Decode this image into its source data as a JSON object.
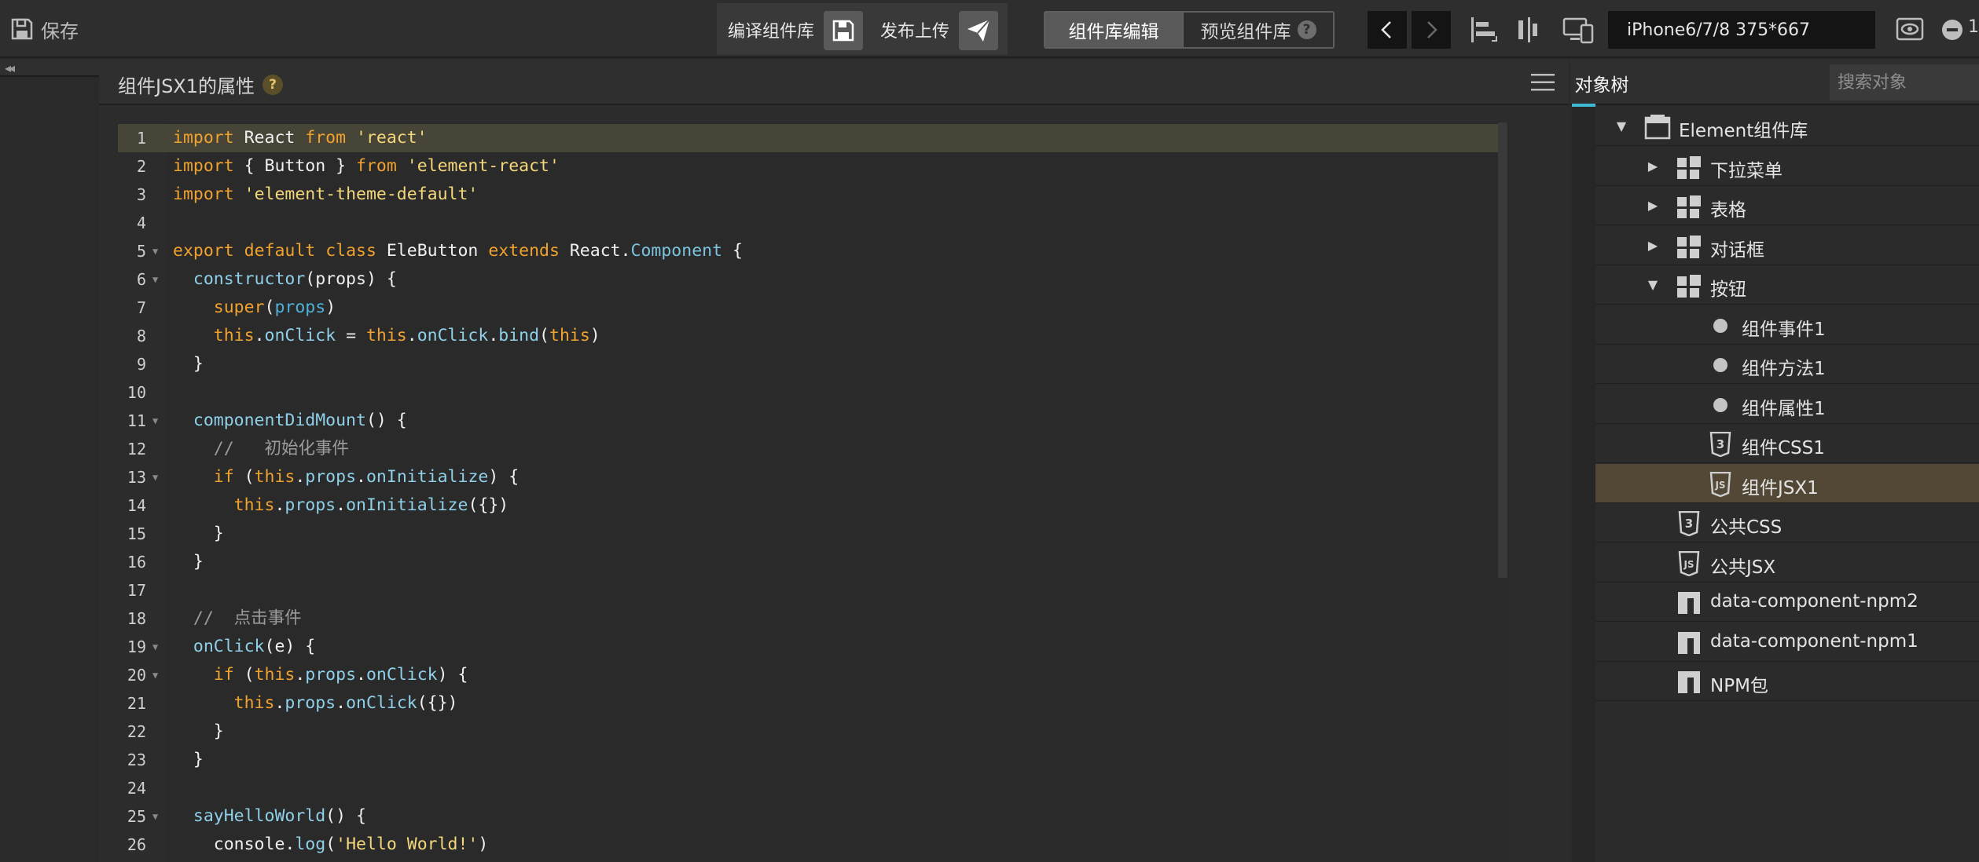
{
  "toolbar": {
    "save_label": "保存",
    "compile_label": "编译组件库",
    "publish_label": "发布上传",
    "mode_edit_label": "组件库编辑",
    "mode_preview_label": "预览组件库",
    "help_symbol": "?",
    "device_label": "iPhone6/7/8 375*667",
    "zoom_label": "1"
  },
  "left_strip": {
    "collapse_symbol": "◂◂"
  },
  "panel": {
    "title": "组件JSX1的属性",
    "help_symbol": "?"
  },
  "editor": {
    "active_line": 1,
    "lines": [
      {
        "n": "1",
        "fold": false,
        "tokens": [
          [
            "kw",
            "import"
          ],
          [
            "plain",
            " React "
          ],
          [
            "kw",
            "from"
          ],
          [
            "plain",
            " "
          ],
          [
            "str",
            "'react'"
          ]
        ]
      },
      {
        "n": "2",
        "fold": false,
        "tokens": [
          [
            "kw",
            "import"
          ],
          [
            "plain",
            " { Button } "
          ],
          [
            "kw",
            "from"
          ],
          [
            "plain",
            " "
          ],
          [
            "str",
            "'element-react'"
          ]
        ]
      },
      {
        "n": "3",
        "fold": false,
        "tokens": [
          [
            "kw",
            "import"
          ],
          [
            "plain",
            " "
          ],
          [
            "str",
            "'element-theme-default'"
          ]
        ]
      },
      {
        "n": "4",
        "fold": false,
        "tokens": []
      },
      {
        "n": "5",
        "fold": true,
        "tokens": [
          [
            "kw",
            "export"
          ],
          [
            "plain",
            " "
          ],
          [
            "kw",
            "default"
          ],
          [
            "plain",
            " "
          ],
          [
            "kw",
            "class"
          ],
          [
            "plain",
            " EleButton "
          ],
          [
            "kw",
            "extends"
          ],
          [
            "plain",
            " React."
          ],
          [
            "cls",
            "Component"
          ],
          [
            "plain",
            " {"
          ]
        ]
      },
      {
        "n": "6",
        "fold": true,
        "tokens": [
          [
            "plain",
            "  "
          ],
          [
            "fn",
            "constructor"
          ],
          [
            "plain",
            "(props) {"
          ]
        ]
      },
      {
        "n": "7",
        "fold": false,
        "tokens": [
          [
            "plain",
            "    "
          ],
          [
            "kw",
            "super"
          ],
          [
            "plain",
            "("
          ],
          [
            "param",
            "props"
          ],
          [
            "plain",
            ")"
          ]
        ]
      },
      {
        "n": "8",
        "fold": false,
        "tokens": [
          [
            "plain",
            "    "
          ],
          [
            "this",
            "this"
          ],
          [
            "plain",
            "."
          ],
          [
            "fn",
            "onClick"
          ],
          [
            "plain",
            " = "
          ],
          [
            "this",
            "this"
          ],
          [
            "plain",
            "."
          ],
          [
            "fn",
            "onClick"
          ],
          [
            "plain",
            "."
          ],
          [
            "fn",
            "bind"
          ],
          [
            "plain",
            "("
          ],
          [
            "this",
            "this"
          ],
          [
            "plain",
            ")"
          ]
        ]
      },
      {
        "n": "9",
        "fold": false,
        "tokens": [
          [
            "plain",
            "  }"
          ]
        ]
      },
      {
        "n": "10",
        "fold": false,
        "tokens": []
      },
      {
        "n": "11",
        "fold": true,
        "tokens": [
          [
            "plain",
            "  "
          ],
          [
            "fn",
            "componentDidMount"
          ],
          [
            "plain",
            "() {"
          ]
        ]
      },
      {
        "n": "12",
        "fold": false,
        "tokens": [
          [
            "plain",
            "    "
          ],
          [
            "cm",
            "//   初始化事件"
          ]
        ]
      },
      {
        "n": "13",
        "fold": true,
        "tokens": [
          [
            "plain",
            "    "
          ],
          [
            "kw",
            "if"
          ],
          [
            "plain",
            " ("
          ],
          [
            "this",
            "this"
          ],
          [
            "plain",
            "."
          ],
          [
            "fn",
            "props"
          ],
          [
            "plain",
            "."
          ],
          [
            "fn",
            "onInitialize"
          ],
          [
            "plain",
            ") {"
          ]
        ]
      },
      {
        "n": "14",
        "fold": false,
        "tokens": [
          [
            "plain",
            "      "
          ],
          [
            "this",
            "this"
          ],
          [
            "plain",
            "."
          ],
          [
            "fn",
            "props"
          ],
          [
            "plain",
            "."
          ],
          [
            "fn",
            "onInitialize"
          ],
          [
            "plain",
            "({})"
          ]
        ]
      },
      {
        "n": "15",
        "fold": false,
        "tokens": [
          [
            "plain",
            "    }"
          ]
        ]
      },
      {
        "n": "16",
        "fold": false,
        "tokens": [
          [
            "plain",
            "  }"
          ]
        ]
      },
      {
        "n": "17",
        "fold": false,
        "tokens": []
      },
      {
        "n": "18",
        "fold": false,
        "tokens": [
          [
            "plain",
            "  "
          ],
          [
            "cm",
            "//  点击事件"
          ]
        ]
      },
      {
        "n": "19",
        "fold": true,
        "tokens": [
          [
            "plain",
            "  "
          ],
          [
            "fn",
            "onClick"
          ],
          [
            "plain",
            "(e) {"
          ]
        ]
      },
      {
        "n": "20",
        "fold": true,
        "tokens": [
          [
            "plain",
            "    "
          ],
          [
            "kw",
            "if"
          ],
          [
            "plain",
            " ("
          ],
          [
            "this",
            "this"
          ],
          [
            "plain",
            "."
          ],
          [
            "fn",
            "props"
          ],
          [
            "plain",
            "."
          ],
          [
            "fn",
            "onClick"
          ],
          [
            "plain",
            ") {"
          ]
        ]
      },
      {
        "n": "21",
        "fold": false,
        "tokens": [
          [
            "plain",
            "      "
          ],
          [
            "this",
            "this"
          ],
          [
            "plain",
            "."
          ],
          [
            "fn",
            "props"
          ],
          [
            "plain",
            "."
          ],
          [
            "fn",
            "onClick"
          ],
          [
            "plain",
            "({})"
          ]
        ]
      },
      {
        "n": "22",
        "fold": false,
        "tokens": [
          [
            "plain",
            "    }"
          ]
        ]
      },
      {
        "n": "23",
        "fold": false,
        "tokens": [
          [
            "plain",
            "  }"
          ]
        ]
      },
      {
        "n": "24",
        "fold": false,
        "tokens": []
      },
      {
        "n": "25",
        "fold": true,
        "tokens": [
          [
            "plain",
            "  "
          ],
          [
            "fn",
            "sayHelloWorld"
          ],
          [
            "plain",
            "() {"
          ]
        ]
      },
      {
        "n": "26",
        "fold": false,
        "tokens": [
          [
            "plain",
            "    console."
          ],
          [
            "fn",
            "log"
          ],
          [
            "plain",
            "("
          ],
          [
            "str",
            "'Hello World!'"
          ],
          [
            "plain",
            ")"
          ]
        ]
      }
    ]
  },
  "right_panel": {
    "tab_label": "对象树",
    "search_placeholder": "搜索对象",
    "tree": [
      {
        "label": "Element组件库",
        "depth": 0,
        "arrow": "down",
        "icon": "folder-icon",
        "selected": false
      },
      {
        "label": "下拉菜单",
        "depth": 1,
        "arrow": "right",
        "icon": "component-icon",
        "selected": false
      },
      {
        "label": "表格",
        "depth": 1,
        "arrow": "right",
        "icon": "component-icon",
        "selected": false
      },
      {
        "label": "对话框",
        "depth": 1,
        "arrow": "right",
        "icon": "component-icon",
        "selected": false
      },
      {
        "label": "按钮",
        "depth": 1,
        "arrow": "down",
        "icon": "component-icon",
        "selected": false
      },
      {
        "label": "组件事件1",
        "depth": 2,
        "arrow": "none",
        "icon": "dot-icon",
        "selected": false
      },
      {
        "label": "组件方法1",
        "depth": 2,
        "arrow": "none",
        "icon": "dot-icon",
        "selected": false
      },
      {
        "label": "组件属性1",
        "depth": 2,
        "arrow": "none",
        "icon": "dot-icon",
        "selected": false
      },
      {
        "label": "组件CSS1",
        "depth": 2,
        "arrow": "none",
        "icon": "css3-icon",
        "selected": false
      },
      {
        "label": "组件JSX1",
        "depth": 2,
        "arrow": "none",
        "icon": "js-icon",
        "selected": true
      },
      {
        "label": "公共CSS",
        "depth": 1,
        "arrow": "none",
        "icon": "css3-icon",
        "selected": false
      },
      {
        "label": "公共JSX",
        "depth": 1,
        "arrow": "none",
        "icon": "js-icon",
        "selected": false
      },
      {
        "label": "data-component-npm2",
        "depth": 1,
        "arrow": "none",
        "icon": "npm-icon",
        "selected": false
      },
      {
        "label": "data-component-npm1",
        "depth": 1,
        "arrow": "none",
        "icon": "npm-icon",
        "selected": false
      },
      {
        "label": "NPM包",
        "depth": 1,
        "arrow": "none",
        "icon": "npm-icon",
        "selected": false
      }
    ]
  },
  "colors": {
    "accent": "#3dbad1",
    "selected_row": "#524835",
    "active_line": "#464537",
    "keyword": "#f0a22f",
    "string": "#f4d77b"
  }
}
